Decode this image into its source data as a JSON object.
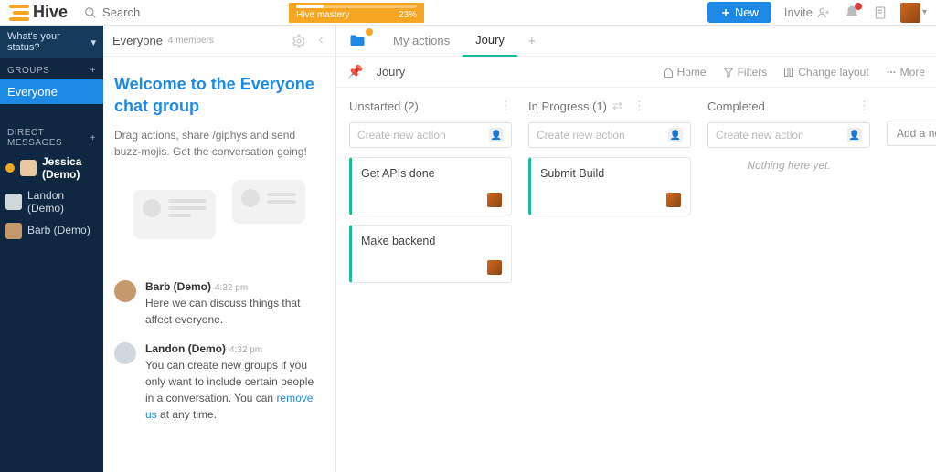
{
  "header": {
    "brand": "Hive",
    "search_placeholder": "Search",
    "mastery_label": "Hive mastery",
    "mastery_pct": "23%",
    "new_label": "New",
    "invite_label": "Invite"
  },
  "leftbar": {
    "status_prompt": "What's your status?",
    "groups_hdr": "GROUPS",
    "groups": [
      {
        "label": "Everyone",
        "active": true
      }
    ],
    "dm_hdr": "DIRECT MESSAGES",
    "dms": [
      {
        "name": "Jessica (Demo)",
        "selected": true
      },
      {
        "name": "Landon (Demo)"
      },
      {
        "name": "Barb (Demo)"
      }
    ]
  },
  "chat": {
    "title": "Everyone",
    "members": "4 members",
    "welcome_title": "Welcome to the Everyone chat group",
    "welcome_text": "Drag actions, share /giphys and send buzz-mojis. Get the conversation going!",
    "messages": [
      {
        "author": "Barb (Demo)",
        "time": "4:32 pm",
        "text": "Here we can discuss things that affect everyone."
      },
      {
        "author": "Landon (Demo)",
        "time": "4:32 pm",
        "text_pre": "You can create new groups if you only want to include certain people in a conversation. You can ",
        "link": "remove us",
        "text_post": " at any time."
      }
    ]
  },
  "board": {
    "tabs": [
      {
        "label": "My actions"
      },
      {
        "label": "Joury",
        "active": true
      }
    ],
    "name": "Joury",
    "toolbar": {
      "home": "Home",
      "filters": "Filters",
      "layout": "Change layout",
      "more": "More"
    },
    "columns": [
      {
        "title": "Unstarted (2)",
        "new_placeholder": "Create new action",
        "cards": [
          {
            "title": "Get APIs done"
          },
          {
            "title": "Make backend"
          }
        ]
      },
      {
        "title": "In Progress (1)",
        "new_placeholder": "Create new action",
        "swap": true,
        "cards": [
          {
            "title": "Submit Build"
          }
        ]
      },
      {
        "title": "Completed",
        "new_placeholder": "Create new action",
        "empty": "Nothing here yet.",
        "cards": []
      }
    ],
    "add_col": "Add a new"
  }
}
